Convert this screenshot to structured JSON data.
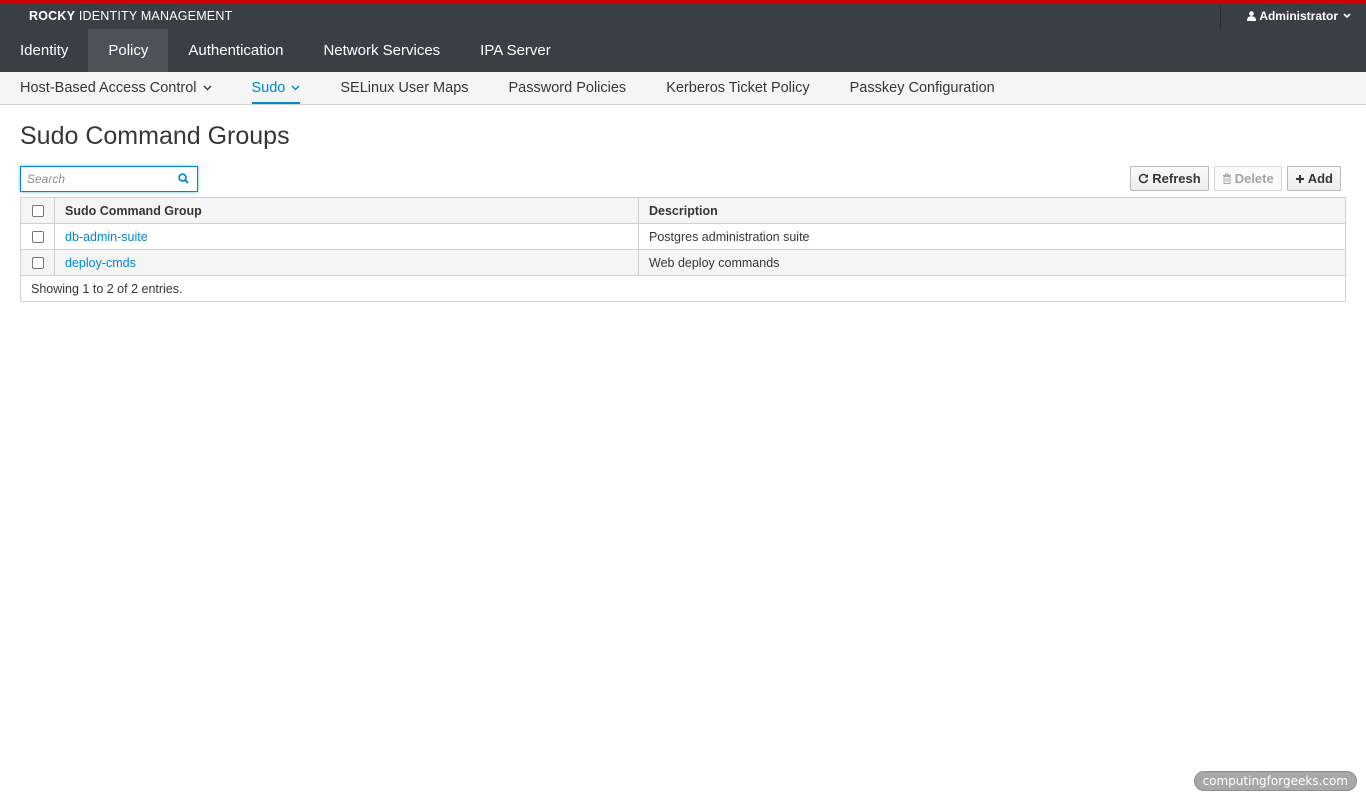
{
  "app": {
    "brand_strong": "ROCKY",
    "brand_rest": " IDENTITY MANAGEMENT",
    "user": "Administrator"
  },
  "main_nav": [
    {
      "label": "Identity",
      "active": false
    },
    {
      "label": "Policy",
      "active": true
    },
    {
      "label": "Authentication",
      "active": false
    },
    {
      "label": "Network Services",
      "active": false
    },
    {
      "label": "IPA Server",
      "active": false
    }
  ],
  "sub_nav": [
    {
      "label": "Host-Based Access Control",
      "dropdown": true,
      "active": false
    },
    {
      "label": "Sudo",
      "dropdown": true,
      "active": true
    },
    {
      "label": "SELinux User Maps",
      "dropdown": false,
      "active": false
    },
    {
      "label": "Password Policies",
      "dropdown": false,
      "active": false
    },
    {
      "label": "Kerberos Ticket Policy",
      "dropdown": false,
      "active": false
    },
    {
      "label": "Passkey Configuration",
      "dropdown": false,
      "active": false
    }
  ],
  "page": {
    "title": "Sudo Command Groups"
  },
  "search": {
    "placeholder": "Search",
    "value": ""
  },
  "toolbar": {
    "refresh_label": "Refresh",
    "delete_label": "Delete",
    "add_label": "Add"
  },
  "table": {
    "columns": [
      "Sudo Command Group",
      "Description"
    ],
    "rows": [
      {
        "name": "db-admin-suite",
        "description": "Postgres administration suite"
      },
      {
        "name": "deploy-cmds",
        "description": "Web deploy commands"
      }
    ],
    "footer": "Showing 1 to 2 of 2 entries."
  },
  "watermark": "computingforgeeks.com",
  "colors": {
    "accent": "#0088ce",
    "topbar": "#393f44",
    "topbar_stripe": "#cc0000"
  }
}
